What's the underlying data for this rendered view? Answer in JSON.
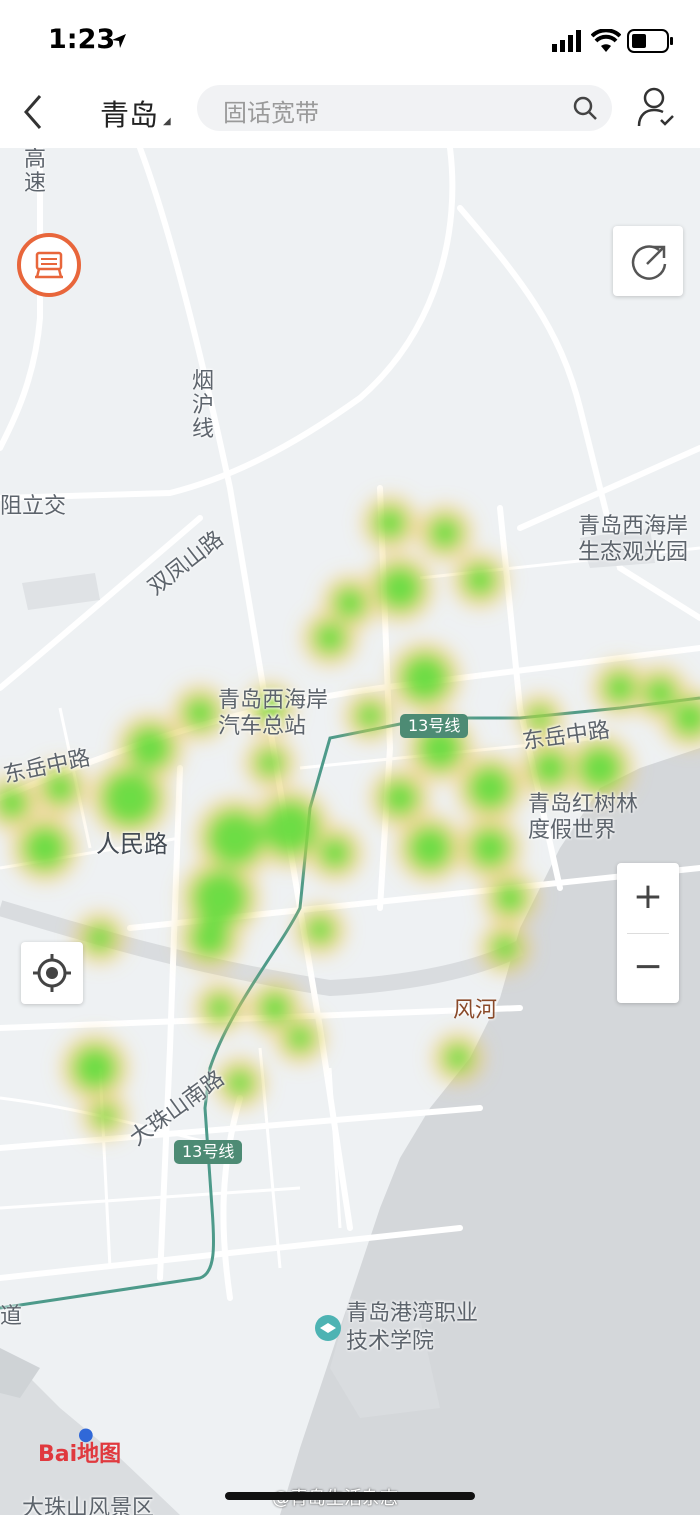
{
  "status_bar": {
    "time": "1:23"
  },
  "nav": {
    "city": "青岛",
    "search_placeholder": "固话宽带"
  },
  "map": {
    "labels": {
      "gaosu": "高速",
      "yanhu": "烟沪线",
      "shuangfengshan": "双凤山路",
      "zhilijiao": "阻立交",
      "xihaian_park": "青岛西海岸\n生态观光园",
      "bus_station": "青岛西海岸\n汽车总站",
      "dongyue_w": "东岳中路",
      "dongyue_e": "东岳中路",
      "renmin": "人民路",
      "mangrove": "青岛红树林\n度假世界",
      "fenghe": "风河",
      "dazhushannan": "大珠山南路",
      "college": "青岛港湾职业\n技术学院",
      "dao": "道",
      "scenic": "大珠山风景区"
    },
    "metro_badges": [
      "13号线",
      "13号线"
    ],
    "zoom_in": "+",
    "zoom_out": "−",
    "logo": "Bai地图",
    "watermark": "@青岛生活杂志"
  }
}
